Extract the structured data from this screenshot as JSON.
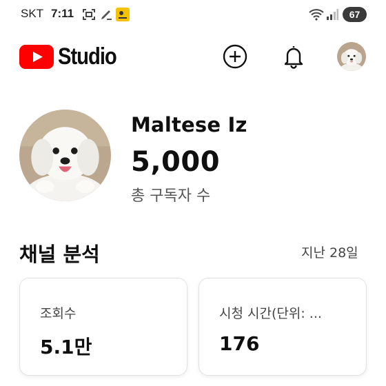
{
  "status_bar": {
    "carrier": "SKT",
    "time": "7:11",
    "battery": "67"
  },
  "header": {
    "logo_text": "Studio",
    "icons": [
      "youtube-play-icon",
      "add-icon",
      "bell-icon",
      "account-avatar"
    ]
  },
  "channel": {
    "name": "Maltese Iz",
    "subscriber_count": "5,000",
    "subscriber_label": "총 구독자 수"
  },
  "analytics": {
    "title": "채널 분석",
    "period": "지난 28일",
    "cards": [
      {
        "label": "조회수",
        "value": "5.1만"
      },
      {
        "label": "시청 시간(단위: ...",
        "value": "176"
      }
    ]
  },
  "colors": {
    "brand_red": "#ff0000",
    "text_primary": "#0f0f0f",
    "text_secondary": "#555555"
  }
}
